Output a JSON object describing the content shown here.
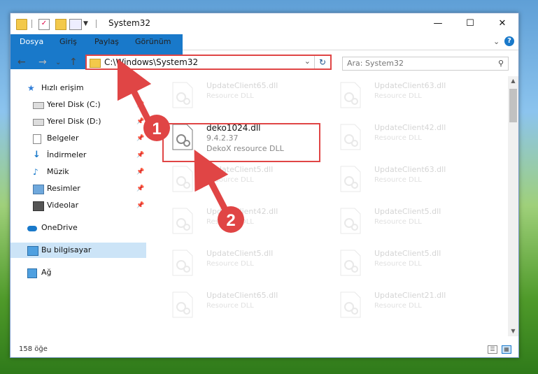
{
  "window": {
    "title": "System32",
    "controls": {
      "minimize": "—",
      "maximize": "☐",
      "close": "✕"
    }
  },
  "ribbon": {
    "tabs": [
      "Dosya",
      "Giriş",
      "Paylaş",
      "Görünüm"
    ],
    "help": "?"
  },
  "address": {
    "path": "C:\\Windows\\System32",
    "search_placeholder": "Ara: System32"
  },
  "sidebar": {
    "items": [
      {
        "label": "Hızlı erişim",
        "icon": "star-icon",
        "pinned": false
      },
      {
        "label": "Yerel Disk (C:)",
        "icon": "drive-icon",
        "pinned": true
      },
      {
        "label": "Yerel Disk (D:)",
        "icon": "drive-icon",
        "pinned": true
      },
      {
        "label": "Belgeler",
        "icon": "documents-icon",
        "pinned": true
      },
      {
        "label": "İndirmeler",
        "icon": "download-icon",
        "pinned": true
      },
      {
        "label": "Müzik",
        "icon": "music-icon",
        "pinned": true
      },
      {
        "label": "Resimler",
        "icon": "pictures-icon",
        "pinned": true
      },
      {
        "label": "Videolar",
        "icon": "videos-icon",
        "pinned": true
      },
      {
        "label": "OneDrive",
        "icon": "cloud-icon",
        "pinned": false
      },
      {
        "label": "Bu bilgisayar",
        "icon": "computer-icon",
        "pinned": false,
        "selected": true
      },
      {
        "label": "Ağ",
        "icon": "network-icon",
        "pinned": false
      }
    ]
  },
  "files": {
    "highlighted": {
      "name": "deko1024.dll",
      "version": "9.4.2.37",
      "type": "DekoX resource DLL"
    },
    "faded": [
      {
        "name": "UpdateClient65.dll",
        "type": "Resource DLL"
      },
      {
        "name": "UpdateClient63.dll",
        "type": "Resource DLL"
      },
      {
        "name": "UpdateClient42.dll",
        "type": "Resource DLL"
      },
      {
        "name": "UpdateClient5.dll",
        "type": "Resource DLL"
      },
      {
        "name": "UpdateClient63.dll",
        "type": "Resource DLL"
      },
      {
        "name": "UpdateClient42.dll",
        "type": "Resource DLL"
      },
      {
        "name": "UpdateClient5.dll",
        "type": "Resource DLL"
      },
      {
        "name": "UpdateClient5.dll",
        "type": "Resource DLL"
      },
      {
        "name": "UpdateClient5.dll",
        "type": "Resource DLL"
      },
      {
        "name": "UpdateClient65.dll",
        "type": "Resource DLL"
      },
      {
        "name": "UpdateClient21.dll",
        "type": "Resource DLL"
      }
    ]
  },
  "status": {
    "count": "158 öğe"
  },
  "annotations": {
    "marker1": "1",
    "marker2": "2",
    "color": "#e04545"
  }
}
